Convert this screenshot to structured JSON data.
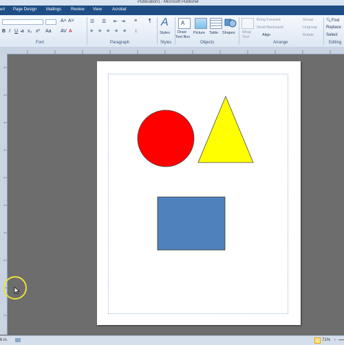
{
  "window": {
    "title": "Publication1 - Microsoft Publisher"
  },
  "tabs": [
    {
      "label": "ert"
    },
    {
      "label": "Page Design"
    },
    {
      "label": "Mailings"
    },
    {
      "label": "Review"
    },
    {
      "label": "View"
    },
    {
      "label": "Acrobat"
    }
  ],
  "ribbon": {
    "groups": {
      "font": "Font",
      "paragraph": "Paragraph",
      "styles": "Styles",
      "objects": "Objects",
      "arrange": "Arrange",
      "editing": "Editing"
    },
    "buttons": {
      "styles": "Styles",
      "draw_text_box_line1": "Draw",
      "draw_text_box_line2": "Text Box",
      "picture": "Picture",
      "table": "Table",
      "shapes": "Shapes",
      "wrap_text_line1": "Wrap",
      "wrap_text_line2": "Text",
      "bring_forward": "Bring Forward",
      "send_backward": "Send Backward",
      "align": "Align",
      "group": "Group",
      "ungroup": "Ungroup",
      "rotate": "Rotate",
      "find": "Find",
      "replace": "Replace",
      "select": "Select"
    }
  },
  "statusbar": {
    "position": "6 in.",
    "zoom": "71%"
  },
  "colors": {
    "circle": "#ff0000",
    "triangle": "#ffff00",
    "rectangle": "#4f81bd",
    "ribbon_tab_bar": "#1f4e86"
  },
  "shapes": [
    {
      "type": "circle"
    },
    {
      "type": "triangle"
    },
    {
      "type": "rectangle"
    }
  ]
}
